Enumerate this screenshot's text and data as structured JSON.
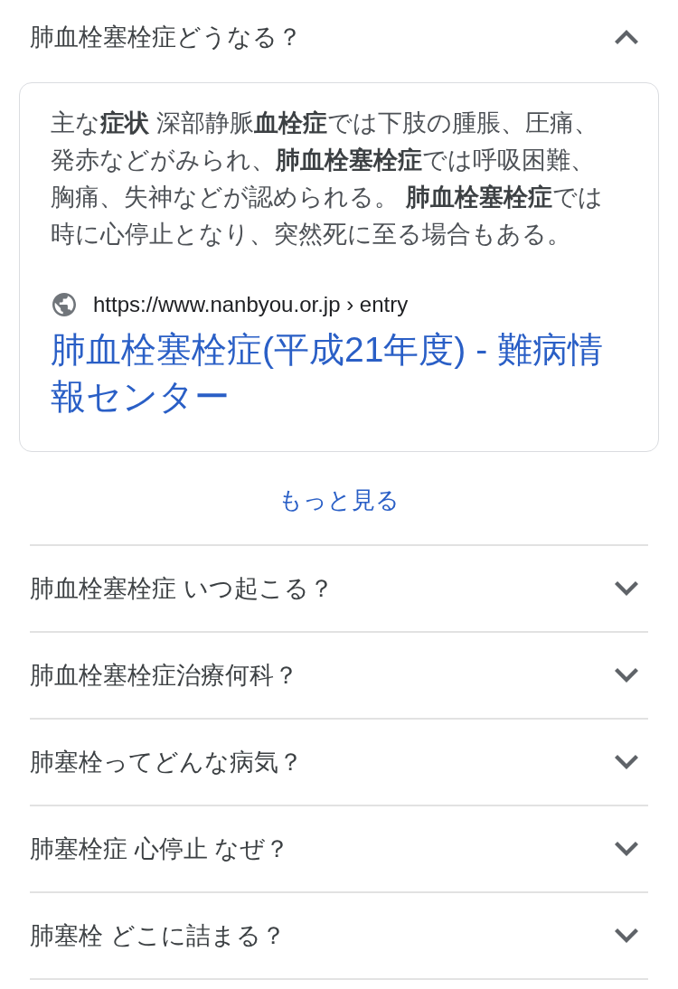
{
  "questions": [
    {
      "question": "肺血栓塞栓症どうなる？",
      "expanded": true,
      "answer": {
        "snippet": "主な**症状** 深部静脈**血栓症**では下肢の腫脹、圧痛、発赤などがみられ、**肺血栓塞栓症**では呼吸困難、胸痛、失神などが認められる。 **肺血栓塞栓症**では時に心停止となり、突然死に至る場合もある。",
        "source": "https://www.nanbyou.or.jp › entry",
        "title": "肺血栓塞栓症(平成21年度) - 難病情報センター",
        "more_link": "もっと見る"
      }
    },
    {
      "question": "肺血栓塞栓症 いつ起こる？",
      "expanded": false
    },
    {
      "question": "肺血栓塞栓症治療何科？",
      "expanded": false
    },
    {
      "question": "肺塞栓ってどんな病気？",
      "expanded": false
    },
    {
      "question": "肺塞栓症 心停止 なぜ？",
      "expanded": false
    },
    {
      "question": "肺塞栓 どこに詰まる？",
      "expanded": false
    }
  ]
}
